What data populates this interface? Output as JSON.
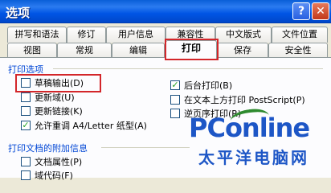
{
  "title": "选项",
  "titlebar_buttons": {
    "help": "?",
    "close": "✕"
  },
  "tabs_row1": [
    "拼写和语法",
    "修订",
    "用户信息",
    "兼容性",
    "中文版式",
    "文件位置"
  ],
  "tabs_row2": [
    "视图",
    "常规",
    "编辑",
    "打印",
    "保存",
    "安全性"
  ],
  "active_tab": "打印",
  "print_options": {
    "label": "打印选项",
    "left": [
      {
        "label": "草稿输出(D)",
        "checked": false
      },
      {
        "label": "更新域(U)",
        "checked": false
      },
      {
        "label": "更新链接(K)",
        "checked": false
      },
      {
        "label": "允许重调 A4/Letter 纸型(A)",
        "checked": true
      }
    ],
    "right": [
      {
        "label": "后台打印(B)",
        "checked": true
      },
      {
        "label": "在文本上方打印 PostScript(P)",
        "checked": false
      },
      {
        "label": "逆页序打印(R)",
        "checked": false
      }
    ]
  },
  "attached_info": {
    "label": "打印文档的附加信息",
    "items": [
      {
        "label": "文档属性(P)",
        "checked": false
      },
      {
        "label": "域代码(F)",
        "checked": false
      }
    ]
  },
  "watermark": {
    "brand": "PConline",
    "brand_cn": "太平洋电脑网"
  },
  "colors": {
    "title_blue": "#0055e5",
    "highlight_red": "#d3262a",
    "section_blue": "#0046d5",
    "check_green": "#21a121"
  }
}
